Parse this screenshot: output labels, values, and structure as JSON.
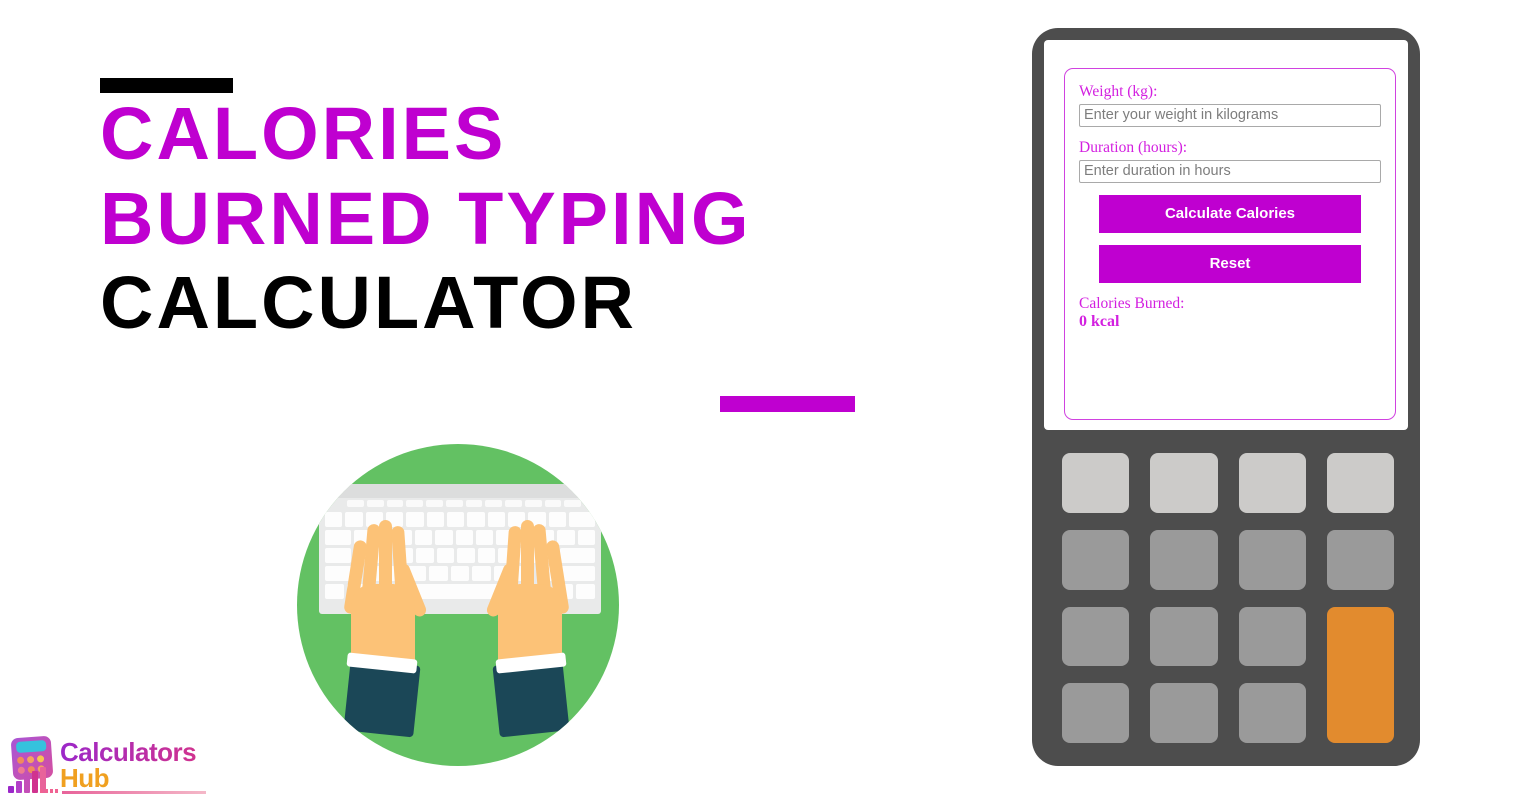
{
  "hero": {
    "title_line_1": "CALORIES",
    "title_line_2": "BURNED TYPING",
    "title_line_3": "CALCULATOR",
    "accent_color": "#bf00d0",
    "dark_color": "#000000"
  },
  "illustration": {
    "name": "hands-typing-on-keyboard",
    "circle_color": "#63c163",
    "keyboard_color": "#e9eaea",
    "skin_color": "#fcc277",
    "sleeve_color": "#1b4757"
  },
  "logo": {
    "word_1": "Calculators",
    "word_2": "Hub",
    "word_1_color": "#9b27c9",
    "word_2_color": "#f0a020"
  },
  "calculator": {
    "body_color": "#4d4d4d",
    "accent_key_color": "#e28b2e",
    "form": {
      "fields": [
        {
          "label": "Weight (kg):",
          "placeholder": "Enter your weight in kilograms",
          "value": ""
        },
        {
          "label": "Duration (hours):",
          "placeholder": "Enter duration in hours",
          "value": ""
        }
      ],
      "calculate_button": "Calculate Calories",
      "reset_button": "Reset",
      "result_label": "Calories Burned:",
      "result_value": "0 kcal"
    },
    "keypad": {
      "rows": 4,
      "columns": 4,
      "light_row_index": 0
    }
  }
}
